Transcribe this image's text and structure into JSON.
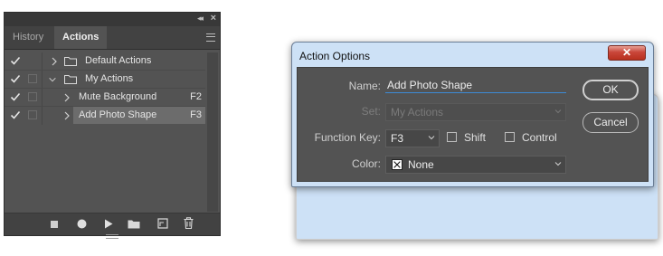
{
  "panel": {
    "tabs": {
      "history": "History",
      "actions": "Actions"
    },
    "rows": [
      {
        "label": "Default Actions",
        "fkey": "",
        "type": "set",
        "expanded": false
      },
      {
        "label": "My Actions",
        "fkey": "",
        "type": "set",
        "expanded": true
      },
      {
        "label": "Mute Background",
        "fkey": "F2",
        "type": "action",
        "expanded": false
      },
      {
        "label": "Add Photo Shape",
        "fkey": "F3",
        "type": "action",
        "expanded": false,
        "selected": true
      }
    ],
    "bottom_icons": [
      "stop-icon",
      "record-icon",
      "play-icon",
      "new-set-icon",
      "new-action-icon",
      "trash-icon"
    ]
  },
  "dialog": {
    "title": "Action Options",
    "close_symbol": "✕",
    "name_label": "Name:",
    "name_value": "Add Photo Shape",
    "set_label": "Set:",
    "set_value": "My Actions",
    "function_key_label": "Function Key:",
    "function_key_value": "F3",
    "shift_label": "Shift",
    "control_label": "Control",
    "color_label": "Color:",
    "color_value": "None",
    "ok_label": "OK",
    "cancel_label": "Cancel"
  },
  "colors": {
    "panel_bg": "#535353",
    "selected_row": "#6c6c6c",
    "dialog_frame": "#cde1f6",
    "close_button": "#c9463a",
    "input_underline": "#3c8ad6"
  }
}
